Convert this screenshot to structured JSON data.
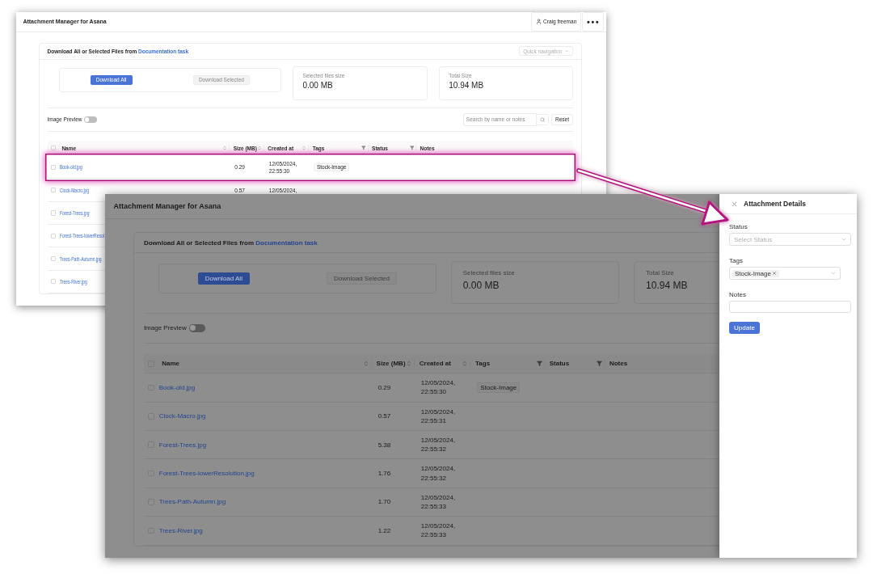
{
  "back_window": {
    "title": "Attachment Manager for Asana",
    "user": "Craig freeman",
    "heading": "Download All or Selected Files from",
    "heading_link": "Documentation task",
    "quick_navigation": {
      "label": "Quick navigation",
      "disabled": true
    },
    "buttons": [
      {
        "label": "Download All",
        "kind": "primary",
        "disabled": false
      },
      {
        "label": "Download Selected",
        "kind": "default",
        "disabled": true
      }
    ],
    "stats": [
      {
        "label": "Selected files size",
        "value": "0.00 MB"
      },
      {
        "label": "Total Size",
        "value": "10.94 MB"
      }
    ],
    "image_preview": {
      "label": "Image Preview",
      "on": false
    },
    "search": {
      "placeholder": "Search by name or notes"
    },
    "reset": "Reset",
    "all_checked": false,
    "columns": [
      {
        "label": "Name",
        "kind": "sort"
      },
      {
        "label": "Size (MB)",
        "kind": "sort"
      },
      {
        "label": "Created at",
        "kind": "sort"
      },
      {
        "label": "Tags",
        "kind": "filter"
      },
      {
        "label": "Status",
        "kind": "filter"
      },
      {
        "label": "Notes",
        "kind": "plain"
      }
    ],
    "rows": [
      {
        "name": "Book-old.jpg",
        "size": "0.29",
        "created": [
          "12/05/2024,",
          "22:55:30"
        ],
        "tags": [
          "Stock-Image"
        ],
        "checked": false,
        "highlighted": true
      },
      {
        "name": "Clock-Macro.jpg",
        "size": "0.57",
        "created": [
          "12/05/2024,"
        ],
        "checked": false,
        "highlighted": false
      },
      {
        "name": "Forest-Trees.jpg",
        "checked": false,
        "highlighted": false
      },
      {
        "name": "Forest-Trees-lowerResol",
        "checked": false,
        "highlighted": false
      },
      {
        "name": "Trees-Path-Autumn.jpg",
        "checked": false,
        "highlighted": false
      },
      {
        "name": "Trees-River.jpg",
        "checked": false,
        "highlighted": false
      }
    ]
  },
  "front_window": {
    "title": "Attachment Manager for Asana",
    "heading": "Download All or Selected Files from",
    "heading_link": "Documentation task",
    "buttons": [
      {
        "label": "Download All",
        "kind": "primary",
        "disabled": false
      },
      {
        "label": "Download Selected",
        "kind": "default",
        "disabled": true
      }
    ],
    "stats": [
      {
        "label": "Selected files size",
        "value": "0.00 MB"
      },
      {
        "label": "Total Size",
        "value": "10.94 MB"
      }
    ],
    "image_preview": {
      "label": "Image Preview",
      "on": false
    },
    "all_checked": false,
    "columns": [
      {
        "label": "Name",
        "kind": "sort"
      },
      {
        "label": "Size (MB)",
        "kind": "sort"
      },
      {
        "label": "Created at",
        "kind": "sort"
      },
      {
        "label": "Tags",
        "kind": "filter"
      },
      {
        "label": "Status",
        "kind": "filter"
      },
      {
        "label": "Notes",
        "kind": "plain"
      }
    ],
    "rows": [
      {
        "name": "Book-old.jpg",
        "size": "0.29",
        "created": [
          "12/05/2024,",
          "22:55:30"
        ],
        "tags": [
          "Stock-Image"
        ],
        "checked": false
      },
      {
        "name": "Clock-Macro.jpg",
        "size": "0.57",
        "created": [
          "12/05/2024,",
          "22:55:31"
        ],
        "checked": false
      },
      {
        "name": "Forest-Trees.jpg",
        "size": "5.38",
        "created": [
          "12/05/2024,",
          "22:55:32"
        ],
        "checked": false
      },
      {
        "name": "Forest-Trees-lowerResolution.jpg",
        "size": "1.76",
        "created": [
          "12/05/2024,",
          "22:55:32"
        ],
        "checked": false
      },
      {
        "name": "Trees-Path-Autumn.jpg",
        "size": "1.70",
        "created": [
          "12/05/2024,",
          "22:55:33"
        ],
        "checked": false
      },
      {
        "name": "Trees-River.jpg",
        "size": "1.22",
        "created": [
          "12/05/2024,",
          "22:55:33"
        ],
        "checked": false
      }
    ]
  },
  "drawer": {
    "title": "Attachment Details",
    "fields": [
      {
        "kind": "select",
        "label": "Status",
        "placeholder": "Select Status"
      },
      {
        "kind": "tags",
        "label": "Tags",
        "tags": [
          "Stock-Image"
        ]
      },
      {
        "kind": "text",
        "label": "Notes"
      }
    ],
    "submit": "Update"
  }
}
